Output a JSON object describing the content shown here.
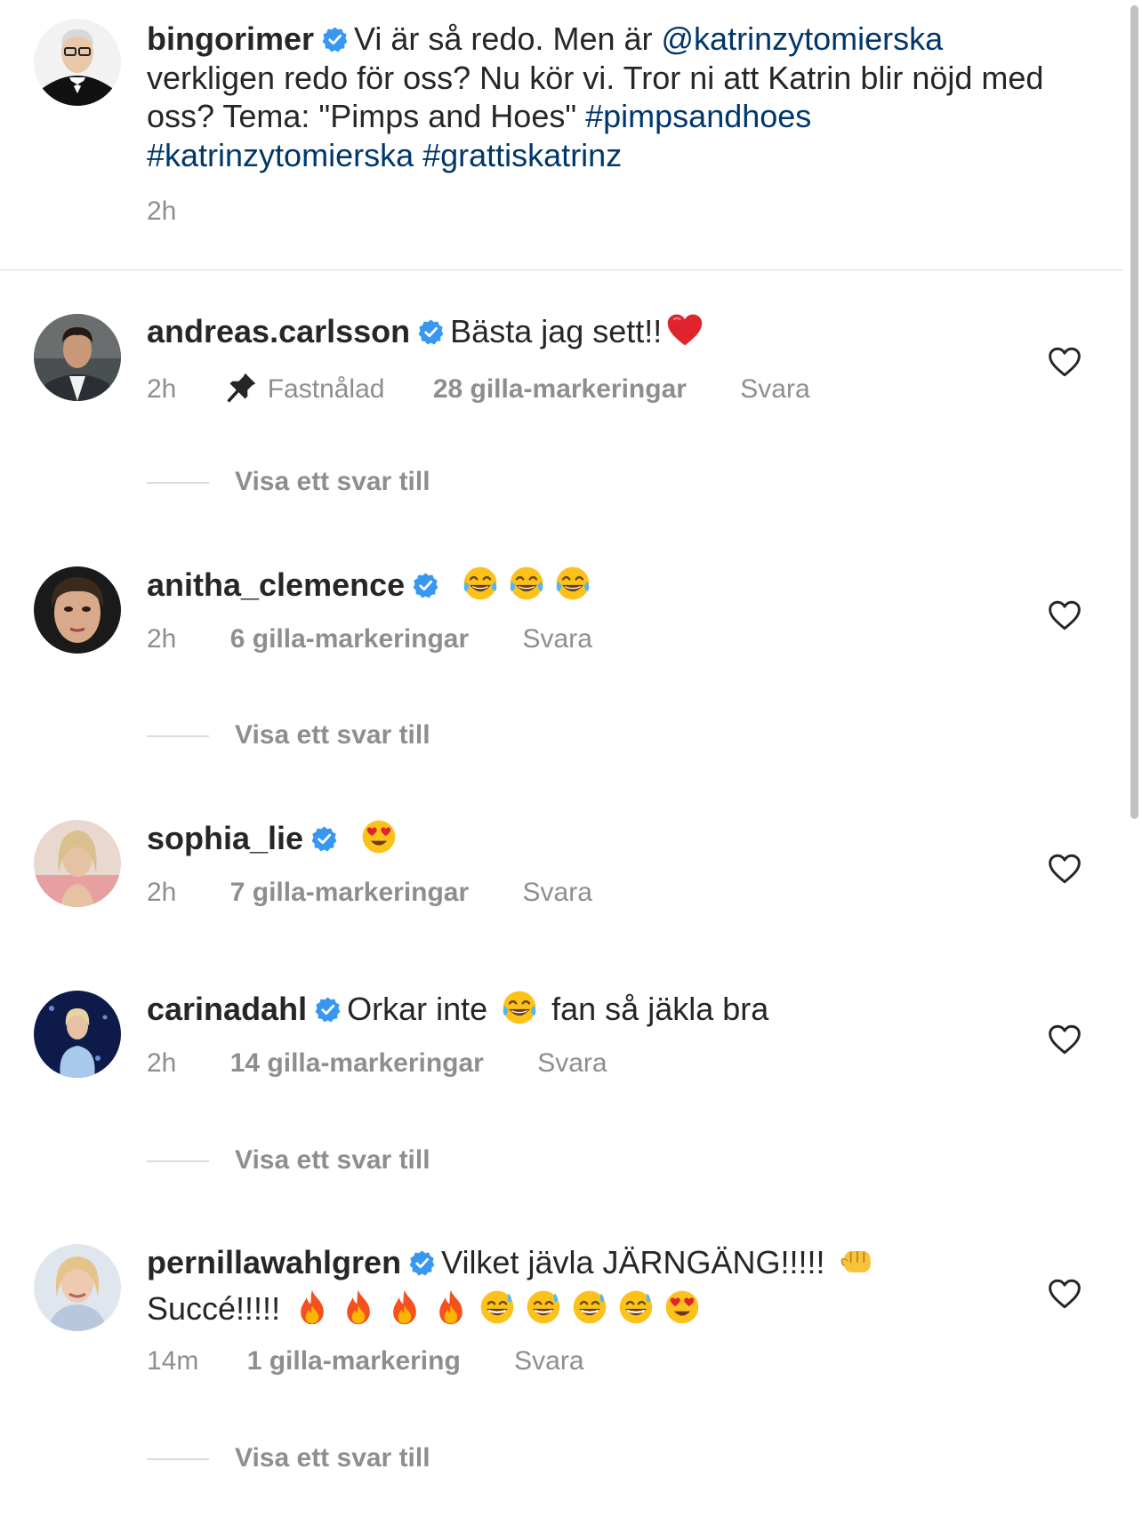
{
  "colors": {
    "text": "#262626",
    "secondary": "#8e8e8e",
    "link": "#00376b",
    "verified": "#3897f0",
    "divider": "#dbdbdb"
  },
  "caption": {
    "username": "bingorimer",
    "text_before_mention": "Vi är så redo. Men är ",
    "mention": "@katrinzytomierska",
    "text_after_mention": " verkligen redo för oss? Nu kör vi. Tror ni att Katrin blir nöjd med oss? Tema: \"Pimps and Hoes\" ",
    "hashtag_1": "#pimpsandhoes",
    "hashtag_2": "#katrinzytomierska",
    "hashtag_3": "#grattiskatrinz",
    "time": "2h"
  },
  "comments": [
    {
      "username": "andreas.carlsson",
      "text": "Bästa jag sett!!",
      "emojis": [
        "red-heart"
      ],
      "time": "2h",
      "pinned_label": "Fastnålad",
      "likes": "28 gilla-markeringar",
      "reply": "Svara",
      "view_replies": "Visa ett svar till"
    },
    {
      "username": "anitha_clemence",
      "text": "",
      "emojis": [
        "tears-of-joy",
        "tears-of-joy",
        "tears-of-joy"
      ],
      "time": "2h",
      "likes": "6 gilla-markeringar",
      "reply": "Svara",
      "view_replies": "Visa ett svar till"
    },
    {
      "username": "sophia_lie",
      "text": "",
      "emojis": [
        "heart-eyes"
      ],
      "time": "2h",
      "likes": "7 gilla-markeringar",
      "reply": "Svara"
    },
    {
      "username": "carinadahl",
      "text_before": "Orkar inte ",
      "text_after": " fan så jäkla bra",
      "emojis": [
        "tears-of-joy"
      ],
      "time": "2h",
      "likes": "14 gilla-markeringar",
      "reply": "Svara",
      "view_replies": "Visa ett svar till"
    },
    {
      "username": "pernillawahlgren",
      "text": "Vilket jävla JÄRNGÄNG!!!!! ",
      "text_line2": "Succé!!!!! ",
      "emojis": [
        "oncoming-fist",
        "fire",
        "fire",
        "fire",
        "fire",
        "grinning-sweat",
        "grinning-sweat",
        "grinning-sweat",
        "grinning-sweat",
        "heart-eyes"
      ],
      "time": "14m",
      "likes": "1 gilla-markering",
      "reply": "Svara",
      "view_replies": "Visa ett svar till"
    }
  ]
}
